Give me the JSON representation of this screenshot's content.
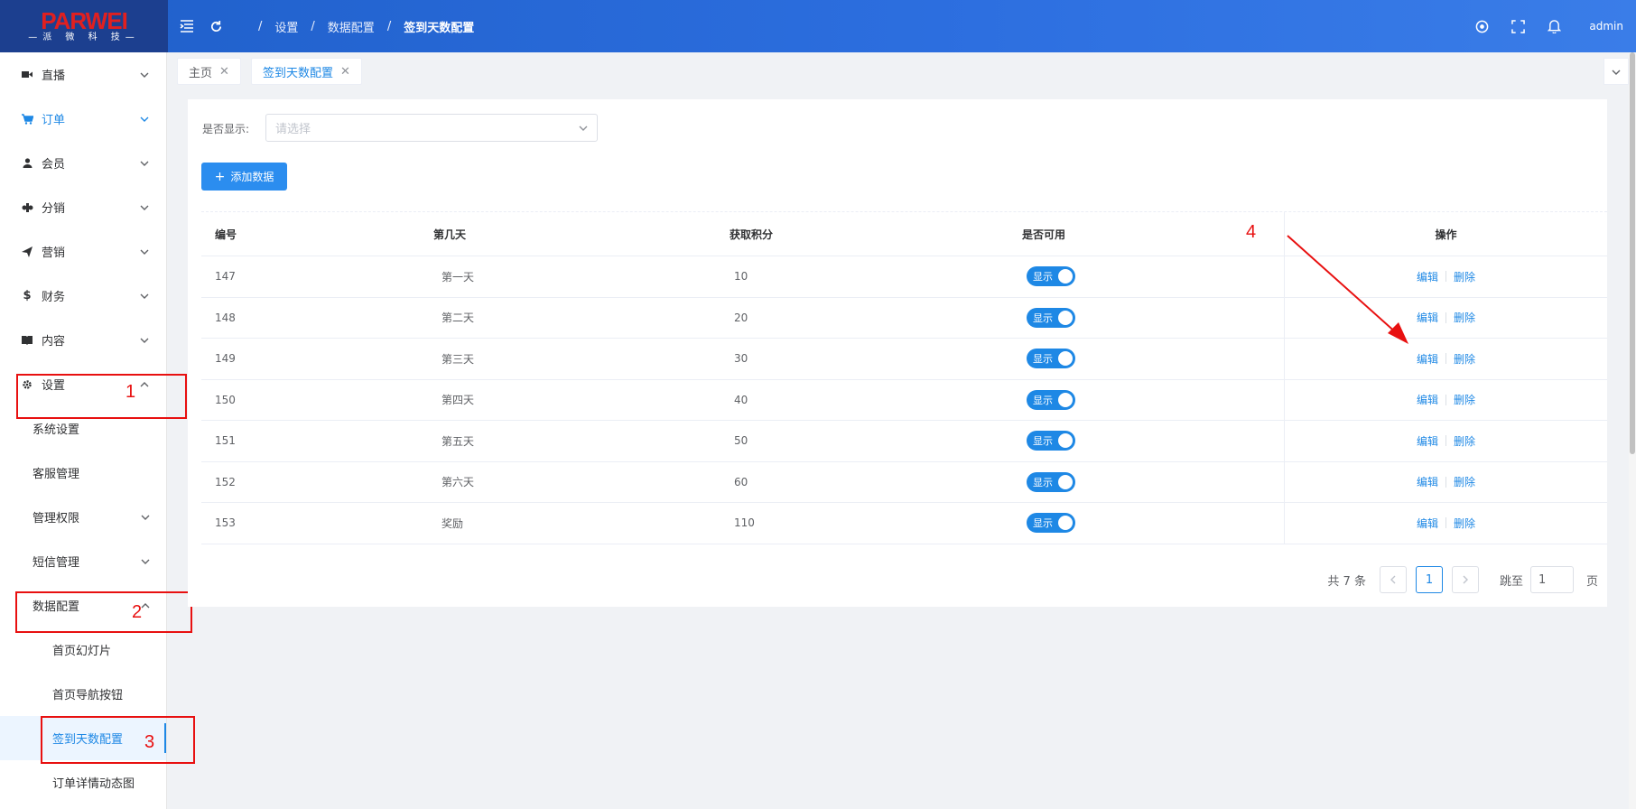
{
  "header": {
    "logo_brand": "PARWEI",
    "logo_sub": "—派 微 科 技—",
    "breadcrumb": [
      "/",
      "设置",
      "/",
      "数据配置",
      "/",
      "签到天数配置"
    ],
    "user": "admin"
  },
  "sidebar": {
    "items": [
      {
        "label": "直播",
        "icon": "video-icon"
      },
      {
        "label": "订单",
        "icon": "cart-icon"
      },
      {
        "label": "会员",
        "icon": "user-icon"
      },
      {
        "label": "分销",
        "icon": "share-icon"
      },
      {
        "label": "营销",
        "icon": "send-icon"
      },
      {
        "label": "财务",
        "icon": "dollar-icon"
      },
      {
        "label": "内容",
        "icon": "book-icon"
      },
      {
        "label": "设置",
        "icon": "gear-icon"
      }
    ],
    "settings_sub": [
      "系统设置",
      "客服管理",
      "管理权限",
      "短信管理",
      "数据配置"
    ],
    "data_sub": [
      "首页幻灯片",
      "首页导航按钮",
      "签到天数配置",
      "订单详情动态图"
    ]
  },
  "annotations": [
    "1",
    "2",
    "3",
    "4"
  ],
  "tabs": [
    {
      "label": "主页",
      "close": "✕"
    },
    {
      "label": "签到天数配置",
      "close": "✕"
    }
  ],
  "filter": {
    "label": "是否显示:",
    "placeholder": "请选择"
  },
  "add_button": "添加数据",
  "table": {
    "headers": [
      "编号",
      "第几天",
      "获取积分",
      "是否可用",
      "操作"
    ],
    "rows": [
      {
        "id": "147",
        "day": "第一天",
        "points": "10",
        "status": "显示"
      },
      {
        "id": "148",
        "day": "第二天",
        "points": "20",
        "status": "显示"
      },
      {
        "id": "149",
        "day": "第三天",
        "points": "30",
        "status": "显示"
      },
      {
        "id": "150",
        "day": "第四天",
        "points": "40",
        "status": "显示"
      },
      {
        "id": "151",
        "day": "第五天",
        "points": "50",
        "status": "显示"
      },
      {
        "id": "152",
        "day": "第六天",
        "points": "60",
        "status": "显示"
      },
      {
        "id": "153",
        "day": "奖励",
        "points": "110",
        "status": "显示"
      }
    ],
    "edit_label": "编辑",
    "delete_label": "删除"
  },
  "pager": {
    "total": "共 7 条",
    "current": "1",
    "jump_label": "跳至",
    "jump_value": "1",
    "page_unit": "页"
  },
  "colors": {
    "accent": "#1e88e5",
    "header": "#2d6fe0",
    "annotation": "#e81010"
  }
}
